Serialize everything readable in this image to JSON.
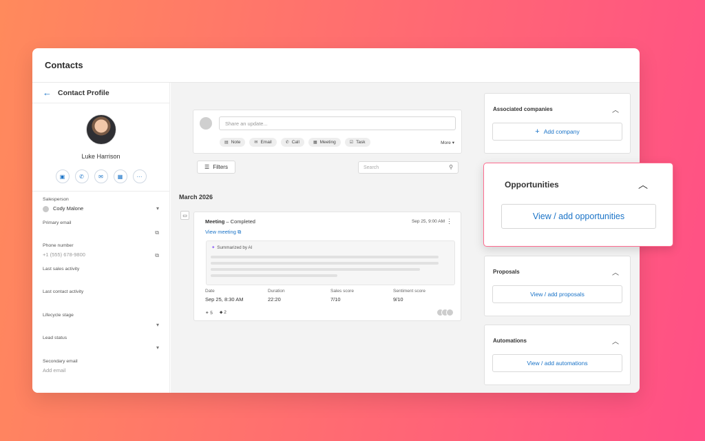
{
  "app": {
    "title": "Contacts"
  },
  "breadcrumb": {
    "back_icon": "arrow-left-icon",
    "label": "Contact Profile"
  },
  "profile": {
    "name": "Luke Harrison",
    "actions": [
      {
        "name": "message",
        "icon": "▣"
      },
      {
        "name": "call",
        "icon": "✆"
      },
      {
        "name": "email",
        "icon": "✉"
      },
      {
        "name": "calendar",
        "icon": "▦"
      },
      {
        "name": "more",
        "icon": "···"
      }
    ]
  },
  "fields": {
    "salesperson_label": "Salesperson",
    "salesperson_value": "Cody Malone",
    "primary_email_label": "Primary email",
    "phone_label": "Phone number",
    "phone_value": "+1 (555) 678-9800",
    "last_sales_label": "Last sales activity",
    "last_contact_label": "Last contact activity",
    "lifecycle_label": "Lifecycle stage",
    "lead_status_label": "Lead status",
    "secondary_email_label": "Secondary email",
    "secondary_email_placeholder": "Add email"
  },
  "share": {
    "placeholder": "Share an update...",
    "actions": [
      "Note",
      "Email",
      "Call",
      "Meeting",
      "Task"
    ],
    "more": "More ▾"
  },
  "toolbar": {
    "filters": "Filters",
    "search_placeholder": "Search"
  },
  "timeline": {
    "month": "March 2026",
    "activity": {
      "type": "Meeting",
      "status": " – Completed",
      "datetime": "Sep 25, 9:00 AM",
      "link": "View meeting ⧉",
      "summary_label": "Summarized by AI",
      "metrics": [
        {
          "label": "Date",
          "value": "Sep 25, 8:30 AM"
        },
        {
          "label": "Duration",
          "value": "22:20"
        },
        {
          "label": "Sales score",
          "value": "7/10"
        },
        {
          "label": "Sentiment score",
          "value": "9/10"
        }
      ],
      "links_count": "5",
      "tags_count": "2"
    }
  },
  "panels": {
    "companies": {
      "title": "Associated companies",
      "button": "Add company"
    },
    "opportunities": {
      "title": "Opportunities",
      "button": "View / add opportunities"
    },
    "proposals": {
      "title": "Proposals",
      "button": "View / add proposals"
    },
    "automations": {
      "title": "Automations",
      "button": "View / add automations"
    }
  },
  "colors": {
    "accent": "#1a73c7",
    "highlight_border": "#ff6b8f"
  }
}
